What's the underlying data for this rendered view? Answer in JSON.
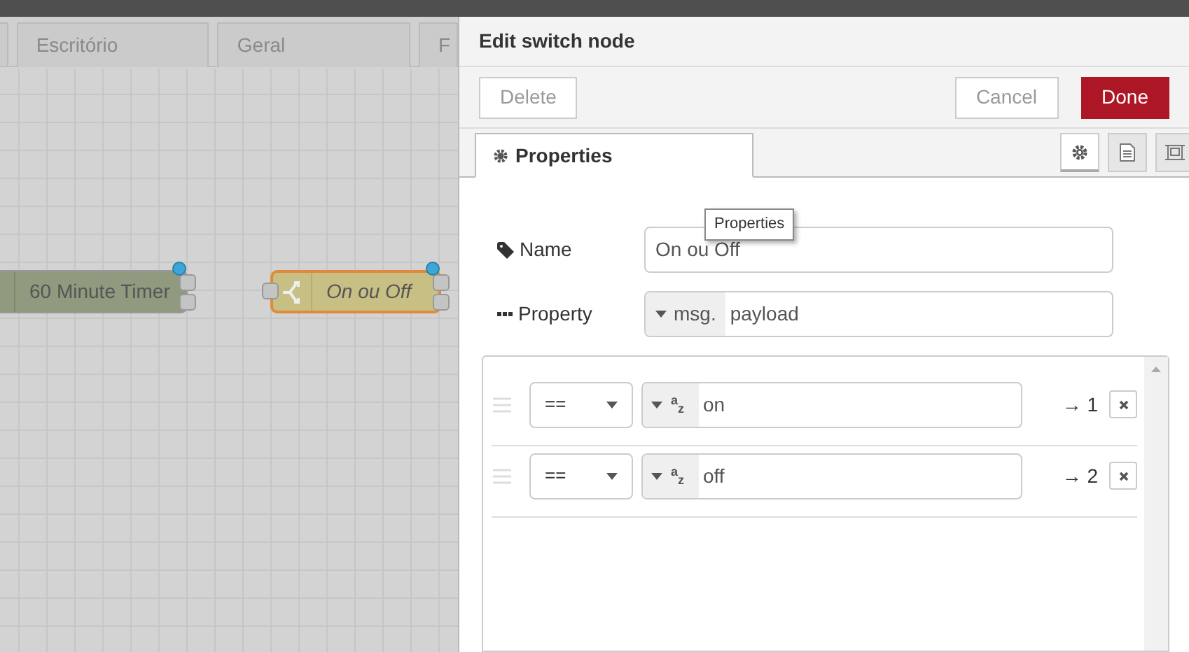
{
  "canvas": {
    "tabs": [
      {
        "label": "Escritório",
        "selected": false
      },
      {
        "label": "Geral",
        "selected": false
      },
      {
        "label": "F",
        "selected": false
      }
    ],
    "nodes": [
      {
        "label": "60 Minute Timer",
        "kind": "inject",
        "selected": false,
        "changed": true
      },
      {
        "label": "On ou Off",
        "kind": "switch",
        "selected": true,
        "changed": true
      }
    ]
  },
  "editor": {
    "title": "Edit switch node",
    "buttons": [
      {
        "label": "Delete",
        "kind": "plain"
      },
      {
        "label": "Cancel",
        "kind": "plain"
      },
      {
        "label": "Done",
        "kind": "primary"
      }
    ],
    "tabs": [
      {
        "label": "Properties",
        "selected": true
      }
    ],
    "view_buttons": [
      {
        "kind": "settings",
        "selected": true
      },
      {
        "kind": "description",
        "selected": false
      },
      {
        "kind": "appearance",
        "selected": false
      }
    ],
    "tooltip": "Properties",
    "name": {
      "label": "Name",
      "value": "On ou Off"
    },
    "property": {
      "label": "Property",
      "prefix": "msg.",
      "value": "payload"
    },
    "rules": [
      {
        "operator": "==",
        "type_glyph": "az",
        "value": "on",
        "output": "→ 1"
      },
      {
        "operator": "==",
        "type_glyph": "az",
        "value": "off",
        "output": "→ 2"
      }
    ]
  }
}
